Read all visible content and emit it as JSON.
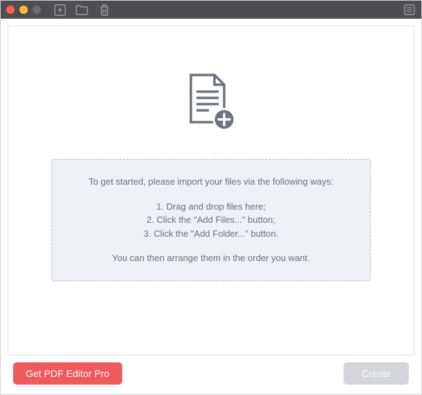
{
  "instructions": {
    "intro": "To get started, please import your files via the following ways:",
    "step1": "1. Drag and drop files here;",
    "step2": "2. Click the \"Add Files...\" button;",
    "step3": "3. Click the \"Add Folder...\" button.",
    "outro": "You can then arrange them in the order you want."
  },
  "footer": {
    "get_pro_label": "Get PDF Editor Pro",
    "create_label": "Create"
  }
}
